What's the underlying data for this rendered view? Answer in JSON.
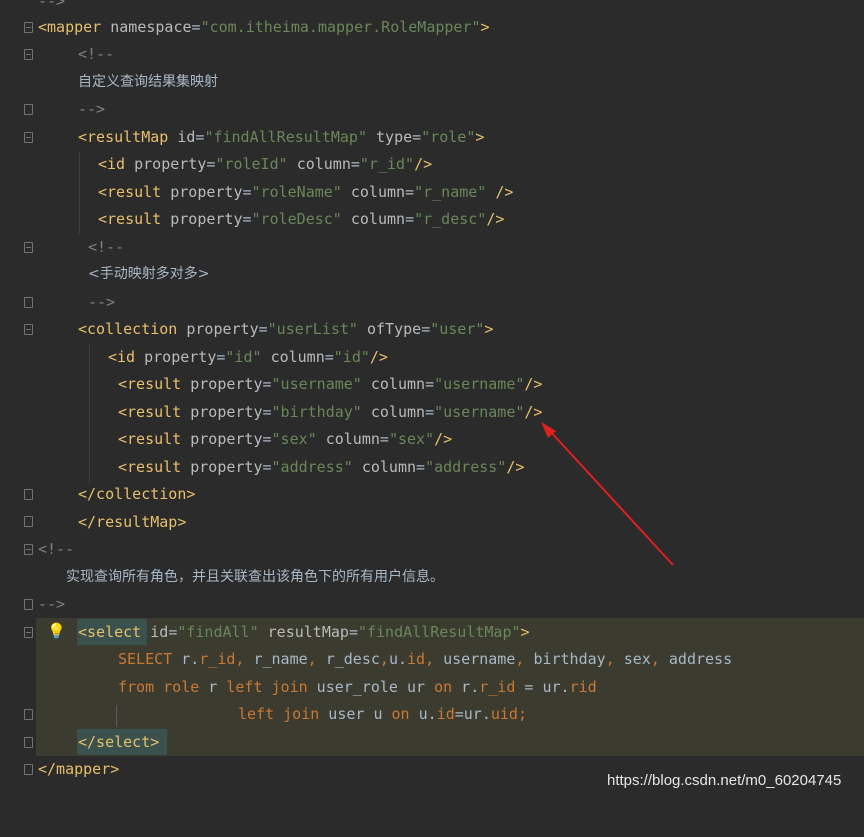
{
  "editor": {
    "top_stub": "-->",
    "mapper_open": {
      "tag": "<mapper",
      "attr": "namespace",
      "eq": "=",
      "value": "\"com.itheima.mapper.RoleMapper\"",
      "close": ">"
    },
    "comment1_open": "<!--",
    "comment1_text": "自定义查询结果集映射",
    "comment1_close": "-->",
    "resultmap_open": {
      "tag": "<resultMap",
      "attr1": "id",
      "val1": "\"findAllResultMap\"",
      "attr2": "type",
      "val2": "\"role\"",
      "close": ">"
    },
    "id_line": {
      "tag": "<id",
      "attr1": "property",
      "val1": "\"roleId\"",
      "attr2": "column",
      "val2": "\"r_id\"",
      "close": "/>"
    },
    "result1": {
      "tag": "<result",
      "attr1": "property",
      "val1": "\"roleName\"",
      "attr2": "column",
      "val2": "\"r_name\"",
      "close": " />"
    },
    "result2": {
      "tag": "<result",
      "attr1": "property",
      "val1": "\"roleDesc\"",
      "attr2": "column",
      "val2": "\"r_desc\"",
      "close": "/>"
    },
    "comment2_open": "<!--",
    "comment2_text": "<手动映射多对多>",
    "comment2_close": "-->",
    "collection_open": {
      "tag": "<collection",
      "attr1": "property",
      "val1": "\"userList\"",
      "attr2": "ofType",
      "val2": "\"user\"",
      "close": ">"
    },
    "c_id": {
      "tag": "<id",
      "attr1": "property",
      "val1": "\"id\"",
      "attr2": "column",
      "val2": "\"id\"",
      "close": "/>"
    },
    "c_r1": {
      "tag": "<result",
      "attr1": "property",
      "val1": "\"username\"",
      "attr2": "column",
      "val2": "\"username\"",
      "close": "/>"
    },
    "c_r2": {
      "tag": "<result",
      "attr1": "property",
      "val1": "\"birthday\"",
      "attr2": "column",
      "val2": "\"username\"",
      "close": "/>"
    },
    "c_r3": {
      "tag": "<result",
      "attr1": "property",
      "val1": "\"sex\"",
      "attr2": "column",
      "val2": "\"sex\"",
      "close": "/>"
    },
    "c_r4": {
      "tag": "<result",
      "attr1": "property",
      "val1": "\"address\"",
      "attr2": "column",
      "val2": "\"address\"",
      "close": "/>"
    },
    "collection_close": "</collection>",
    "resultmap_close": "</resultMap>",
    "comment3_open": "<!--",
    "comment3_text": "实现查询所有角色，并且关联查出该角色下的所有用户信息。",
    "comment3_close": "-->",
    "select_open": {
      "tag": "<select",
      "attr1": "id",
      "val1": "\"findAll\"",
      "attr2": "resultMap",
      "val2": "\"findAllResultMap\"",
      "close": ">"
    },
    "sql1": {
      "kw": "SELECT",
      "p1": " r.",
      "f1": "r_id",
      "c1": ", ",
      "p2": "r_name",
      "c2": ", ",
      "p3": "r_desc",
      "c3": ",",
      "p4": "u.",
      "f4": "id",
      "c4": ", ",
      "p5": "username",
      "c5": ", ",
      "p6": "birthday",
      "c6": ", ",
      "p7": "sex",
      "c7": ", ",
      "p8": "address"
    },
    "sql2": {
      "kw1": "from",
      "w1": " ",
      "kw2": "role",
      "p1": " r ",
      "kw3": "left join",
      "p2": " user_role ur ",
      "kw4": "on",
      "p3": " r.",
      "f1": "r_id",
      "p4": " = ur.",
      "f2": "rid"
    },
    "sql3": {
      "kw1": "left join",
      "p1": " user u ",
      "kw2": "on",
      "p2": " u.",
      "f1": "id",
      "p3": "=ur.",
      "f2": "uid",
      "semi": ";"
    },
    "select_close": "</select>",
    "mapper_close": "</mapper>"
  },
  "watermark": "https://blog.csdn.net/m0_60204745",
  "colors": {
    "background": "#2b2b2b",
    "tag": "#e8bf6a",
    "value": "#6a8759",
    "keyword": "#cc7832",
    "comment": "#808080",
    "highlight": "#3b3b30",
    "arrow": "#e02020"
  }
}
